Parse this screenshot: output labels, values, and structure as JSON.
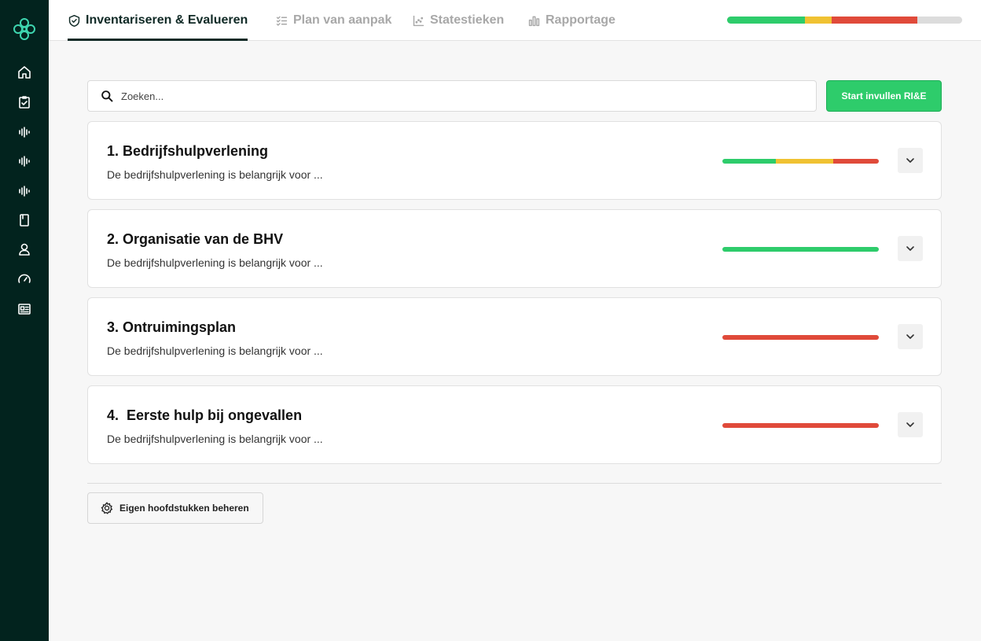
{
  "colors": {
    "sidebar_bg": "#02231e",
    "accent_green": "#2ecc6b",
    "status_green": "#2ecc6b",
    "status_yellow": "#f0c232",
    "status_red": "#e04a3a",
    "status_empty": "#dcdcdc"
  },
  "sidebar": {
    "logo": "flower-logo-icon",
    "items": [
      {
        "icon": "home-icon"
      },
      {
        "icon": "clipboard-check-icon"
      },
      {
        "icon": "waveform-icon"
      },
      {
        "icon": "waveform-icon"
      },
      {
        "icon": "waveform-icon"
      },
      {
        "icon": "book-icon"
      },
      {
        "icon": "user-icon"
      },
      {
        "icon": "speedometer-icon"
      },
      {
        "icon": "newspaper-icon"
      }
    ]
  },
  "header": {
    "tabs": [
      {
        "label": "Inventariseren & Evalueren",
        "icon": "shield-check-icon",
        "active": true
      },
      {
        "label": "Plan van aanpak",
        "icon": "checklist-icon",
        "active": false
      },
      {
        "label": "Statestieken",
        "icon": "scatter-chart-icon",
        "active": false
      },
      {
        "label": "Rapportage",
        "icon": "bar-chart-icon",
        "active": false
      }
    ],
    "overall_progress": {
      "green": 0.33,
      "yellow": 0.115,
      "red": 0.365,
      "empty": 0.19
    }
  },
  "search": {
    "placeholder": "Zoeken...",
    "value": "",
    "icon": "search-icon"
  },
  "start_button": {
    "label": "Start invullen RI&E"
  },
  "chapters": [
    {
      "title": "1. Bedrijfshulpverlening",
      "description": "De bedrijfshulpverlening is belangrijk voor ...",
      "progress": {
        "green": 0.34,
        "yellow": 0.37,
        "red": 0.29
      }
    },
    {
      "title": "2. Organisatie van de BHV",
      "description": "De bedrijfshulpverlening is belangrijk voor ...",
      "progress": {
        "green": 1.0,
        "yellow": 0,
        "red": 0
      }
    },
    {
      "title": "3. Ontruimingsplan",
      "description": "De bedrijfshulpverlening is belangrijk voor ...",
      "progress": {
        "green": 0,
        "yellow": 0,
        "red": 1.0
      }
    },
    {
      "title": "4.  Eerste hulp bij ongevallen",
      "description": "De bedrijfshulpverlening is belangrijk voor ...",
      "progress": {
        "green": 0,
        "yellow": 0,
        "red": 1.0
      }
    }
  ],
  "manage_button": {
    "label": "Eigen hoofdstukken beheren",
    "icon": "gear-icon"
  }
}
